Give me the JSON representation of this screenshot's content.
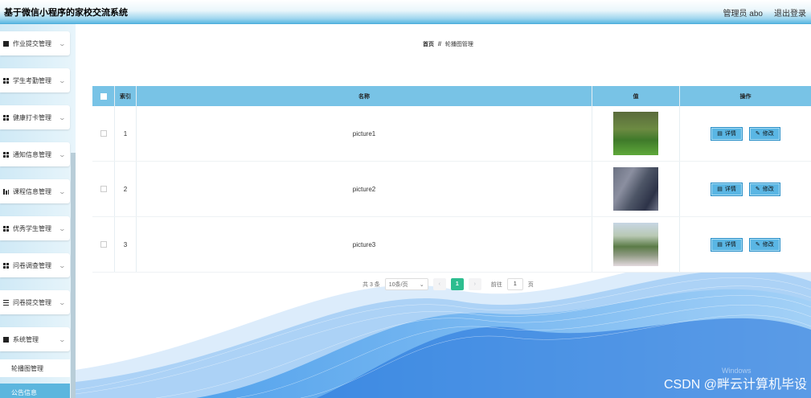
{
  "app_title": "基于微信小程序的家校交流系统",
  "header": {
    "user": "管理员 abo",
    "logout": "退出登录"
  },
  "sidebar": {
    "items": [
      {
        "label": "作业提交管理",
        "icon": "monitor-icon"
      },
      {
        "label": "学生考勤管理",
        "icon": "grid-icon"
      },
      {
        "label": "健康打卡管理",
        "icon": "grid-icon"
      },
      {
        "label": "通知信息管理",
        "icon": "grid-icon"
      },
      {
        "label": "课程信息管理",
        "icon": "chart-icon"
      },
      {
        "label": "优秀学生管理",
        "icon": "grid-icon"
      },
      {
        "label": "问卷调查管理",
        "icon": "grid-icon"
      },
      {
        "label": "问卷提交管理",
        "icon": "list-icon"
      },
      {
        "label": "系统管理",
        "icon": "monitor-icon"
      }
    ],
    "sub_items": [
      "轮播图管理",
      "公告信息"
    ]
  },
  "breadcrumb": {
    "home": "首页",
    "sep": "//",
    "current": "轮播图管理"
  },
  "table": {
    "headers": {
      "index": "索引",
      "name": "名称",
      "value": "值",
      "actions": "操作"
    },
    "rows": [
      {
        "index": "1",
        "name": "picture1"
      },
      {
        "index": "2",
        "name": "picture2"
      },
      {
        "index": "3",
        "name": "picture3"
      }
    ],
    "detail_label": "详情",
    "edit_label": "修改"
  },
  "pagination": {
    "total": "共 3 条",
    "page_size": "10条/页",
    "current_page": "1",
    "goto_label": "前往",
    "goto_value": "1",
    "page_suffix": "页"
  },
  "watermark": "CSDN @畔云计算机毕设",
  "windows_hint": "Windows",
  "colors": {
    "header_accent": "#5cb8e2",
    "table_header": "#78c3e6",
    "active_page": "#2dbd8f",
    "button": "#5ab6e4"
  }
}
